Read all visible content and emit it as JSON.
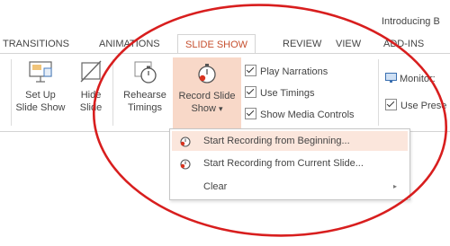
{
  "window": {
    "title": "Introducing B"
  },
  "tabs": [
    {
      "label": "TRANSITIONS",
      "active": false
    },
    {
      "label": "ANIMATIONS",
      "active": false
    },
    {
      "label": "SLIDE SHOW",
      "active": true
    },
    {
      "label": "REVIEW",
      "active": false
    },
    {
      "label": "VIEW",
      "active": false
    },
    {
      "label": "ADD-INS",
      "active": false
    }
  ],
  "ribbon": {
    "setup_line1": "Set Up",
    "setup_line2": "Slide Show",
    "hide_line1": "Hide",
    "hide_line2": "Slide",
    "rehearse_line1": "Rehearse",
    "rehearse_line2": "Timings",
    "record_line1": "Record Slide",
    "record_line2": "Show",
    "record_dropdown_glyph": "▾",
    "checkboxes": [
      {
        "label": "Play Narrations",
        "checked": true
      },
      {
        "label": "Use Timings",
        "checked": true
      },
      {
        "label": "Show Media Controls",
        "checked": true
      }
    ],
    "monitor_label": "Monitor:",
    "use_presenter_label": "Use Prese",
    "use_presenter_checked": true
  },
  "dropdown_menu": {
    "items": [
      {
        "label": "Start Recording from Beginning...",
        "icon": "record-icon",
        "highlighted": true
      },
      {
        "label": "Start Recording from Current Slide...",
        "icon": "record-icon",
        "highlighted": false
      },
      {
        "label": "Clear",
        "icon": "",
        "submenu_glyph": "▸",
        "highlighted": false
      }
    ]
  },
  "colors": {
    "accent": "#c6502f",
    "highlight": "#f8d8c8",
    "menu_hover": "#fbe6dc",
    "annotation_ellipse": "#d81e1e"
  }
}
